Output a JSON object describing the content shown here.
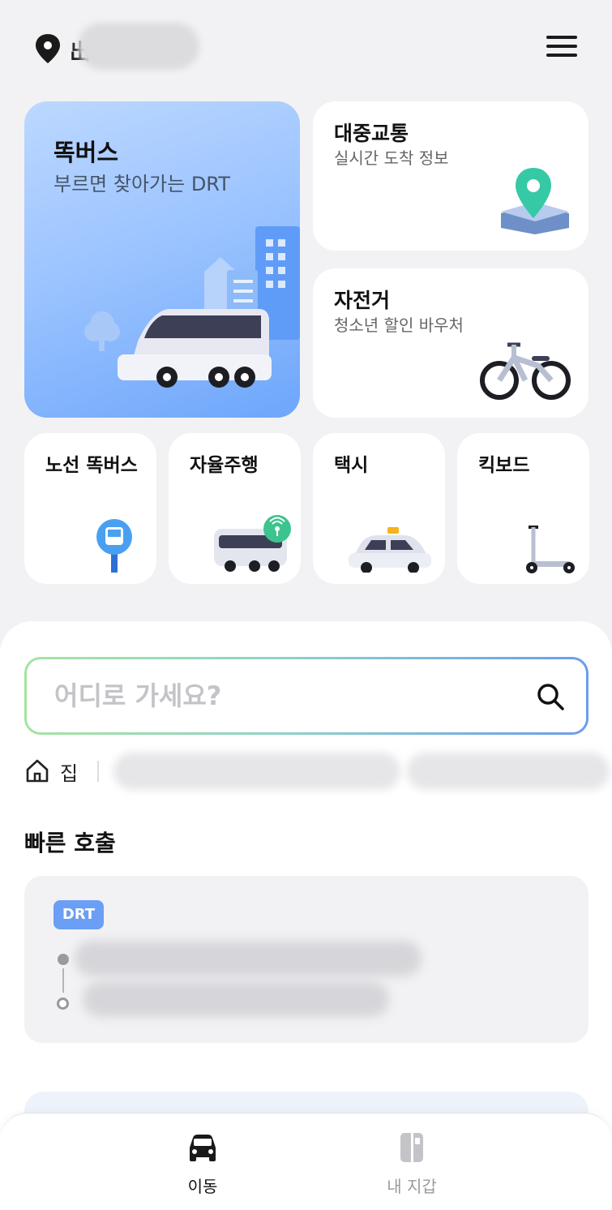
{
  "header": {
    "location_prefix": "出",
    "location_icon": "map-pin-icon",
    "menu_icon": "hamburger-menu-icon"
  },
  "cards": {
    "drt": {
      "title": "똑버스",
      "subtitle": "부르면 찾아가는 DRT"
    },
    "transit": {
      "title": "대중교통",
      "subtitle": "실시간 도착 정보"
    },
    "bike": {
      "title": "자전거",
      "subtitle": "청소년 할인 바우처"
    },
    "small": [
      {
        "title": "노선 똑버스"
      },
      {
        "title": "자율주행"
      },
      {
        "title": "택시"
      },
      {
        "title": "킥보드"
      }
    ]
  },
  "search": {
    "placeholder": "어디로 가세요?",
    "home_label": "집"
  },
  "quick_call": {
    "title": "빠른 호출",
    "badge": "DRT"
  },
  "bottom_nav": [
    {
      "label": "이동",
      "active": true
    },
    {
      "label": "내 지갑",
      "active": false
    }
  ],
  "colors": {
    "accent_blue": "#6b9ef5",
    "drt_card_gradient_start": "#bcd8ff",
    "drt_card_gradient_end": "#6ea6fb",
    "background": "#f2f2f4"
  }
}
